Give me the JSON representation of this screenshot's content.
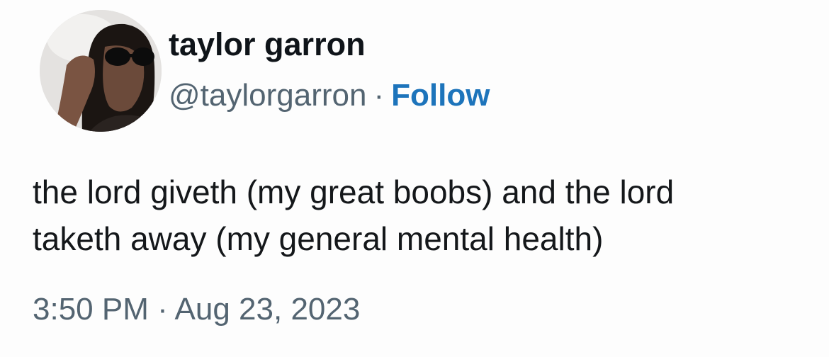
{
  "author": {
    "display_name": "taylor garron",
    "handle": "@taylorgarron",
    "separator": "·",
    "follow_label": "Follow",
    "avatar_icon": "avatar-photo"
  },
  "tweet": {
    "text_lines": [
      "the lord giveth (my great boobs) and the lord",
      "taketh away (my general mental health)"
    ],
    "timestamp": "3:50 PM · Aug 23, 2023"
  },
  "colors": {
    "follow": "#1d74bb",
    "secondary_text": "#536471",
    "primary_text": "#0f1419"
  }
}
